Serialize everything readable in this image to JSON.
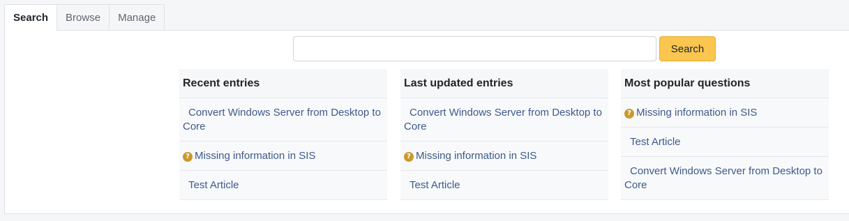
{
  "tabs": [
    {
      "label": "Search",
      "active": true
    },
    {
      "label": "Browse",
      "active": false
    },
    {
      "label": "Manage",
      "active": false
    }
  ],
  "search": {
    "value": "",
    "placeholder": "",
    "button_label": "Search"
  },
  "columns": {
    "recent": {
      "title": "Recent entries",
      "entries": [
        {
          "label": "Convert Windows Server from Desktop to Core",
          "icon": ""
        },
        {
          "label": "Missing information in SIS",
          "icon": "question-icon"
        },
        {
          "label": "Test Article",
          "icon": ""
        }
      ]
    },
    "updated": {
      "title": "Last updated entries",
      "entries": [
        {
          "label": "Convert Windows Server from Desktop to Core",
          "icon": ""
        },
        {
          "label": "Missing information in SIS",
          "icon": "question-icon"
        },
        {
          "label": "Test Article",
          "icon": ""
        }
      ]
    },
    "popular": {
      "title": "Most popular questions",
      "entries": [
        {
          "label": "Missing information in SIS",
          "icon": "question-icon"
        },
        {
          "label": "Test Article",
          "icon": ""
        },
        {
          "label": "Convert Windows Server from Desktop to Core",
          "icon": ""
        }
      ]
    }
  },
  "colors": {
    "accent_button": "#fbc64f",
    "link": "#3d5a8a",
    "question_icon": "#c99a2e"
  }
}
